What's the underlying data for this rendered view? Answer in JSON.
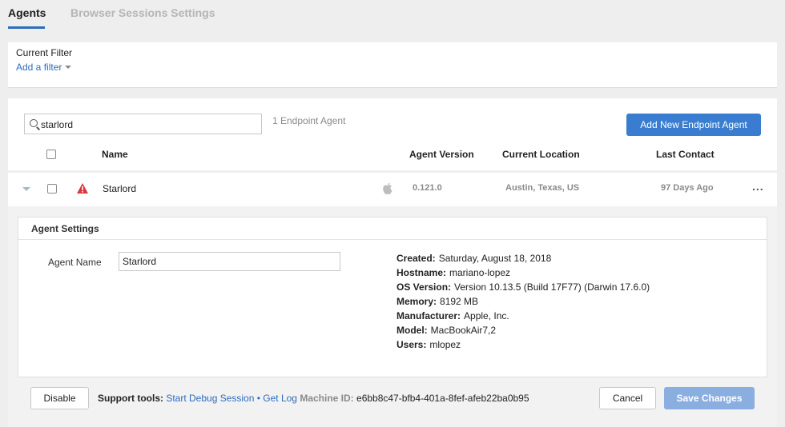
{
  "tabs": {
    "agents": "Agents",
    "browser_sessions": "Browser Sessions Settings"
  },
  "filter": {
    "label": "Current Filter",
    "add": "Add a filter"
  },
  "search": {
    "value": "starlord",
    "placeholder": ""
  },
  "endpoint_count": "1 Endpoint Agent",
  "add_agent_button": "Add New Endpoint Agent",
  "columns": {
    "name": "Name",
    "version": "Agent Version",
    "location": "Current Location",
    "contact": "Last Contact"
  },
  "agent": {
    "name": "Starlord",
    "os_icon": "apple-icon",
    "status_icon": "warning-icon",
    "version": "0.121.0",
    "location": "Austin, Texas, US",
    "last_contact": "97 Days Ago",
    "more": "..."
  },
  "settings": {
    "title": "Agent Settings",
    "name_label": "Agent Name",
    "name_value": "Starlord",
    "info": [
      {
        "key": "Created:",
        "value": "Saturday, August 18, 2018"
      },
      {
        "key": "Hostname:",
        "value": "mariano-lopez"
      },
      {
        "key": "OS Version:",
        "value": "Version 10.13.5 (Build 17F77) (Darwin 17.6.0)"
      },
      {
        "key": "Memory:",
        "value": "8192 MB"
      },
      {
        "key": "Manufacturer:",
        "value": "Apple, Inc."
      },
      {
        "key": "Model:",
        "value": "MacBookAir7,2"
      },
      {
        "key": "Users:",
        "value": "mlopez"
      }
    ]
  },
  "footer": {
    "disable": "Disable",
    "support_label": "Support tools:",
    "debug_link": "Start Debug Session",
    "separator": "•",
    "log_link": "Get Log",
    "machine_label": "Machine ID:",
    "machine_id": "e6bb8c47-bfb4-401a-8fef-afeb22ba0b95",
    "cancel": "Cancel",
    "save": "Save Changes"
  },
  "colors": {
    "accent": "#3a7dd0",
    "warning": "#d9363e",
    "save_disabled": "#8aaee0"
  }
}
